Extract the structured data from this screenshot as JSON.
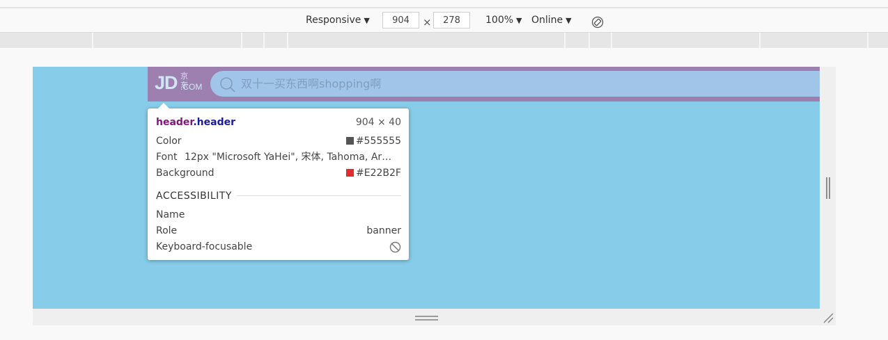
{
  "toolbar": {
    "device": "Responsive",
    "width": "904",
    "times": "×",
    "height": "278",
    "zoom": "100%",
    "network": "Online",
    "rotate_icon": "rotate-icon",
    "caret": "▼"
  },
  "page": {
    "logo_main": "JD",
    "logo_cn": "京东",
    "logo_com": ".COM",
    "search_placeholder": "双十一买东西啊shopping啊",
    "search_icon": "search-icon"
  },
  "tooltip": {
    "selector_tag": "header",
    "selector_class": ".header",
    "size": "904 × 40",
    "color_label": "Color",
    "color_value": "#555555",
    "color_swatch": "#555555",
    "font_label": "Font",
    "font_value": "12px \"Microsoft YaHei\", 宋体, Tahoma, Ar…",
    "background_label": "Background",
    "background_value": "#E22B2F",
    "background_swatch": "#E22B2F",
    "accessibility_title": "ACCESSIBILITY",
    "name_label": "Name",
    "role_label": "Role",
    "role_value": "banner",
    "keyboard_label": "Keyboard-focusable",
    "keyboard_icon": "not-allowed-icon"
  },
  "colors": {
    "viewport_bg": "#87cce9",
    "highlight": "#9d80b0",
    "search_bg": "#a1c4e9"
  }
}
